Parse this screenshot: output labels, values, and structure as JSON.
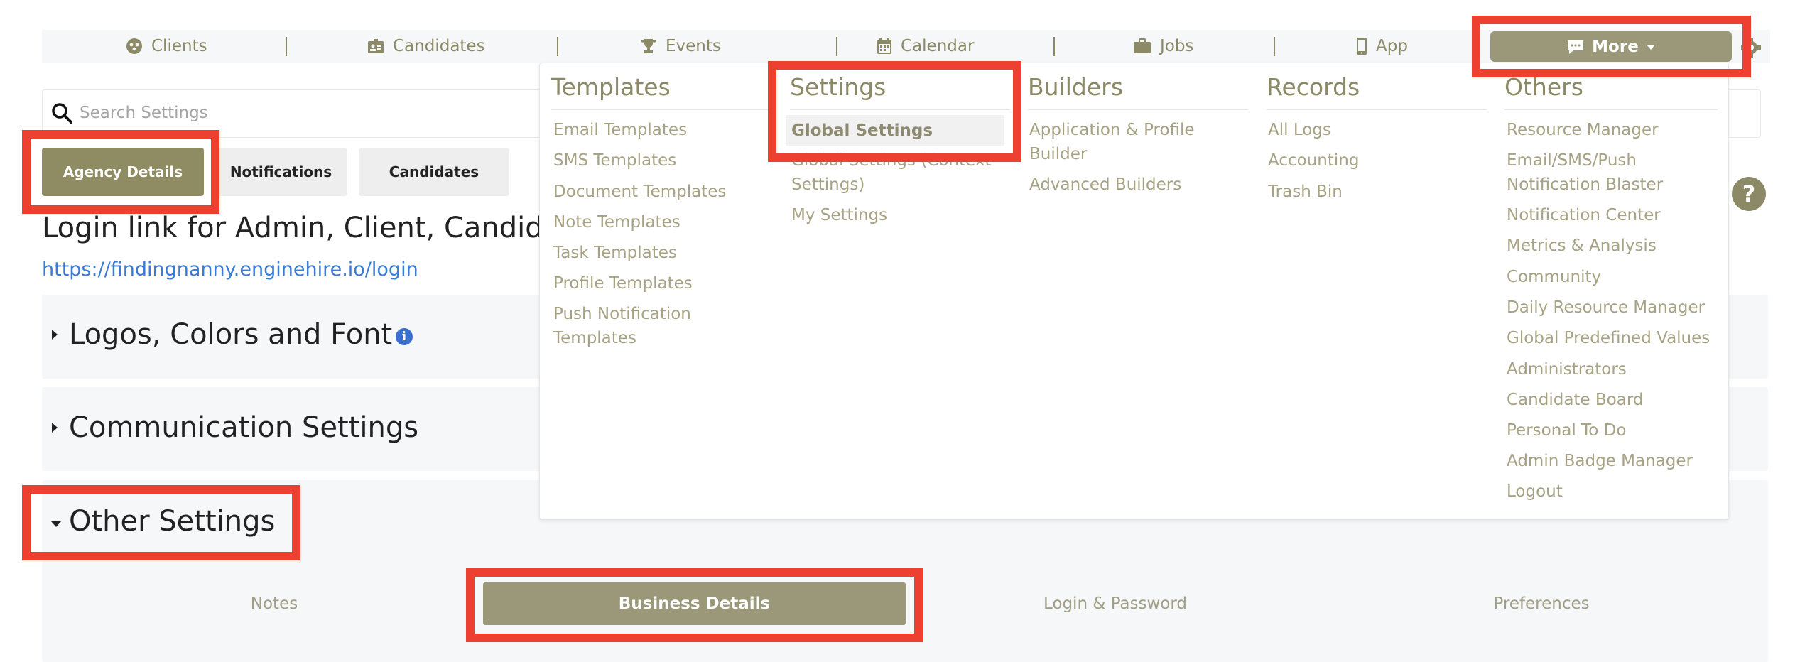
{
  "nav": {
    "items": [
      {
        "label": "Clients",
        "icon": "clients-icon"
      },
      {
        "label": "Candidates",
        "icon": "candidates-icon"
      },
      {
        "label": "Events",
        "icon": "trophy-icon"
      },
      {
        "label": "Calendar",
        "icon": "calendar-icon"
      },
      {
        "label": "Jobs",
        "icon": "briefcase-icon"
      },
      {
        "label": "App",
        "icon": "phone-icon"
      }
    ],
    "more_label": "More"
  },
  "search": {
    "placeholder": "Search Settings"
  },
  "tabs": [
    "Agency Details",
    "Notifications",
    "Candidates"
  ],
  "login": {
    "title": "Login link for Admin, Client, Candida",
    "url": "https://findingnanny.enginehire.io/login"
  },
  "sections": [
    "Logos, Colors and Font",
    "Communication Settings",
    "Other Settings"
  ],
  "subtabs": [
    "Notes",
    "Business Details",
    "Login & Password",
    "Preferences"
  ],
  "menu": {
    "templates": {
      "heading": "Templates",
      "items": [
        "Email Templates",
        "SMS Templates",
        "Document Templates",
        "Note Templates",
        "Task Templates",
        "Profile Templates",
        "Push Notification",
        "Templates"
      ]
    },
    "settings": {
      "heading": "Settings",
      "items": [
        "Global Settings",
        "Global Settings (Context",
        "Settings)",
        "My Settings"
      ]
    },
    "builders": {
      "heading": "Builders",
      "items": [
        "Application & Profile",
        "Builder",
        "Advanced Builders"
      ]
    },
    "records": {
      "heading": "Records",
      "items": [
        "All Logs",
        "Accounting",
        "Trash Bin"
      ]
    },
    "others": {
      "heading": "Others",
      "items": [
        "Resource Manager",
        "Email/SMS/Push",
        "Notification Blaster",
        "Notification Center",
        "Metrics & Analysis",
        "Community",
        "Daily Resource Manager",
        "Global Predefined Values",
        "Administrators",
        "Candidate Board",
        "Personal To Do",
        "Admin Badge Manager",
        "Logout"
      ]
    }
  },
  "colors": {
    "accent": "#8b8966",
    "button": "#9a9878",
    "highlight": "#ee4030",
    "link": "#3a7bd5"
  }
}
